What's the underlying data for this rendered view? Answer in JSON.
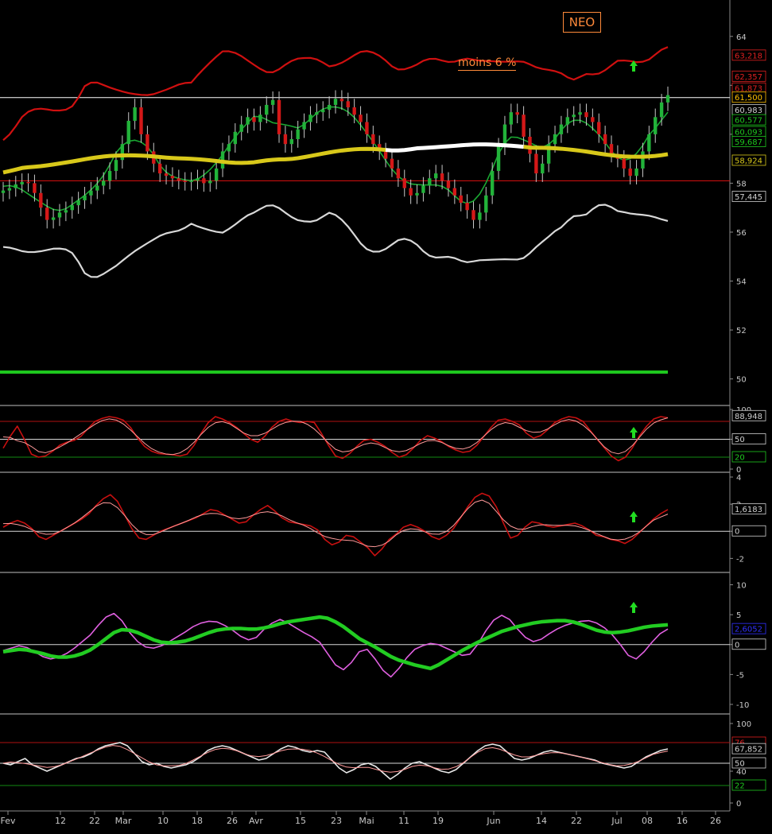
{
  "symbol": "NEO",
  "annotation": "moins 6 %",
  "colors": {
    "background": "#000000",
    "axis": "#8a8a8a",
    "bollinger": "#d01010",
    "bollinger_lower": "#d8d8d8",
    "ma_long": "#d8c81a",
    "ma_long_flat": "#ffffff",
    "ma_short": "#1aa832",
    "candle_up": "#22b33a",
    "candle_down": "#d41818",
    "support": "#e01010",
    "target": "#1ec81e",
    "note": "#ff8a3a",
    "signal": "#22dd22"
  },
  "x_axis": {
    "labels": [
      "Fev",
      "12",
      "22",
      "Mar",
      "10",
      "18",
      "26",
      "Avr",
      "15",
      "23",
      "Mai",
      "11",
      "19",
      "Jun",
      "14",
      "22",
      "Jul",
      "08",
      "16",
      "26"
    ]
  },
  "chart_data": [
    {
      "type": "candlestick",
      "panel": "price",
      "ylim": [
        49.5,
        65
      ],
      "yticks": [
        50,
        52,
        54,
        56,
        58,
        60,
        62,
        64
      ],
      "last_close": 61.5,
      "hlines": [
        {
          "value": 61.5,
          "label": "61,500",
          "color": "#ffffff"
        },
        {
          "value": 58.1,
          "label": "",
          "color": "#e01010"
        },
        {
          "value": 50.279,
          "label": "50,279",
          "color": "#1ec81e"
        }
      ],
      "value_labels": [
        {
          "value": 63.218,
          "label": "63,218",
          "color": "#e02020"
        },
        {
          "value": 62.357,
          "label": "62,357",
          "color": "#e02020"
        },
        {
          "value": 61.873,
          "label": "61,873",
          "color": "#e02020"
        },
        {
          "value": 61.5,
          "label": "61,500",
          "color": "#ffc000"
        },
        {
          "value": 60.983,
          "label": "60,983",
          "color": "#d0d0d0"
        },
        {
          "value": 60.577,
          "label": "60,577",
          "color": "#1ec81e"
        },
        {
          "value": 60.093,
          "label": "60,093",
          "color": "#1ec81e"
        },
        {
          "value": 59.687,
          "label": "59,687",
          "color": "#1ec81e"
        },
        {
          "value": 58.924,
          "label": "58,924",
          "color": "#d8c81a"
        },
        {
          "value": 57.445,
          "label": "57,445",
          "color": "#d0d0d0"
        }
      ],
      "close": [
        57.7,
        57.8,
        57.95,
        58.05,
        58.0,
        57.6,
        57.0,
        56.5,
        56.6,
        56.8,
        56.9,
        57.1,
        57.3,
        57.5,
        57.7,
        57.9,
        58.1,
        58.5,
        58.95,
        59.6,
        60.55,
        61.1,
        60.0,
        59.3,
        58.8,
        58.4,
        58.3,
        58.2,
        58.1,
        58.05,
        58.1,
        58.2,
        58.0,
        58.1,
        58.6,
        59.3,
        59.6,
        60.1,
        60.4,
        60.7,
        60.5,
        60.8,
        61.2,
        61.4,
        60.0,
        59.6,
        59.8,
        60.2,
        60.5,
        60.8,
        60.9,
        61.0,
        61.2,
        61.45,
        61.35,
        61.1,
        60.8,
        60.5,
        60.0,
        59.6,
        59.3,
        59.0,
        58.6,
        58.2,
        57.8,
        57.5,
        57.6,
        57.9,
        58.2,
        58.4,
        58.1,
        57.8,
        57.5,
        57.2,
        56.9,
        56.5,
        56.8,
        57.5,
        58.5,
        59.5,
        60.4,
        60.9,
        60.8,
        59.9,
        59.2,
        58.4,
        58.8,
        59.6,
        60.0,
        60.4,
        60.7,
        60.8,
        60.9,
        60.7,
        60.5,
        60.0,
        59.6,
        59.2,
        59.0,
        58.6,
        58.3,
        58.6,
        59.3,
        60.0,
        60.7,
        61.3,
        61.6
      ]
    },
    {
      "type": "line",
      "panel": "stochastic",
      "ylim": [
        0,
        100
      ],
      "yticks": [
        0,
        50,
        100
      ],
      "ref_lines": [
        80,
        50,
        20
      ],
      "value_labels": [
        {
          "value": 88.948,
          "label": "88,948",
          "color": "#d0d0d0"
        },
        {
          "value": 50,
          "label": "50",
          "color": "#d0d0d0"
        },
        {
          "value": 20,
          "label": "20",
          "color": "#1ec81e"
        }
      ],
      "values": [
        35,
        55,
        72,
        50,
        25,
        20,
        22,
        30,
        40,
        45,
        48,
        55,
        68,
        80,
        85,
        88,
        86,
        82,
        70,
        52,
        38,
        30,
        26,
        25,
        24,
        22,
        25,
        40,
        60,
        78,
        88,
        84,
        78,
        70,
        60,
        50,
        45,
        55,
        70,
        80,
        84,
        80,
        78,
        80,
        78,
        60,
        40,
        22,
        18,
        26,
        38,
        48,
        50,
        45,
        38,
        28,
        20,
        24,
        35,
        48,
        56,
        52,
        46,
        38,
        32,
        28,
        30,
        40,
        55,
        70,
        82,
        84,
        80,
        74,
        60,
        52,
        56,
        66,
        78,
        84,
        88,
        86,
        80,
        65,
        50,
        36,
        22,
        14,
        20,
        36,
        56,
        72,
        84,
        88,
        86
      ]
    },
    {
      "type": "line",
      "panel": "momentum",
      "ylim": [
        -2.8,
        4
      ],
      "yticks": [
        -2,
        0,
        2,
        4
      ],
      "ref_lines": [
        0
      ],
      "value_labels": [
        {
          "value": 1.6183,
          "label": "1,6183",
          "color": "#d0d0d0"
        },
        {
          "value": 0,
          "label": "0",
          "color": "#d0d0d0"
        }
      ],
      "values": [
        0.3,
        0.6,
        0.8,
        0.6,
        0.2,
        -0.4,
        -0.6,
        -0.3,
        0.0,
        0.3,
        0.6,
        0.9,
        1.3,
        1.9,
        2.4,
        2.7,
        2.2,
        1.2,
        0.2,
        -0.5,
        -0.6,
        -0.3,
        0.0,
        0.2,
        0.4,
        0.6,
        0.8,
        1.0,
        1.3,
        1.6,
        1.5,
        1.2,
        0.9,
        0.6,
        0.7,
        1.2,
        1.6,
        1.9,
        1.5,
        1.0,
        0.7,
        0.6,
        0.5,
        0.4,
        0.1,
        -0.6,
        -1.0,
        -0.8,
        -0.3,
        -0.4,
        -0.8,
        -1.2,
        -1.8,
        -1.3,
        -0.6,
        -0.2,
        0.3,
        0.5,
        0.3,
        0.0,
        -0.4,
        -0.6,
        -0.3,
        0.2,
        1.0,
        1.8,
        2.5,
        2.8,
        2.6,
        1.8,
        0.6,
        -0.5,
        -0.3,
        0.3,
        0.7,
        0.6,
        0.4,
        0.3,
        0.4,
        0.5,
        0.6,
        0.4,
        0.1,
        -0.3,
        -0.4,
        -0.6,
        -0.7,
        -0.9,
        -0.6,
        -0.1,
        0.4,
        0.9,
        1.3,
        1.6
      ]
    },
    {
      "type": "line",
      "panel": "macd",
      "ylim": [
        -10.8,
        11
      ],
      "yticks": [
        -10,
        -5,
        0,
        5,
        10
      ],
      "ref_lines": [
        0
      ],
      "value_labels": [
        {
          "value": 2.6052,
          "label": "2,6052",
          "color": "#3030ff"
        },
        {
          "value": 0,
          "label": "0",
          "color": "#d0d0d0"
        }
      ],
      "series": [
        {
          "values": [
            -1,
            -0.6,
            -0.2,
            -0.5,
            -1.2,
            -2.0,
            -2.4,
            -2.1,
            -1.5,
            -0.6,
            0.5,
            1.6,
            3.2,
            4.6,
            5.2,
            4.0,
            2.0,
            0.5,
            -0.4,
            -0.6,
            -0.2,
            0.5,
            1.3,
            2.1,
            3.0,
            3.6,
            3.9,
            3.8,
            3.2,
            2.4,
            1.4,
            0.8,
            1.2,
            2.6,
            3.6,
            4.2,
            3.6,
            2.8,
            2.0,
            1.3,
            0.4,
            -1.5,
            -3.4,
            -4.2,
            -3.0,
            -1.2,
            -0.8,
            -2.4,
            -4.3,
            -5.4,
            -4.0,
            -2.2,
            -0.8,
            -0.2,
            0.2,
            0.0,
            -0.6,
            -1.2,
            -1.8,
            -1.6,
            0.1,
            2.3,
            4.1,
            4.9,
            4.2,
            2.6,
            1.2,
            0.5,
            0.9,
            1.8,
            2.6,
            3.2,
            3.6,
            3.9,
            4.0,
            3.6,
            2.8,
            1.6,
            0.0,
            -1.8,
            -2.4,
            -1.2,
            0.4,
            1.8,
            2.6
          ]
        },
        {
          "values": [
            -1.2,
            -1.0,
            -0.8,
            -0.9,
            -1.2,
            -1.5,
            -1.9,
            -2.1,
            -2.1,
            -1.9,
            -1.5,
            -0.9,
            0.0,
            1.0,
            2.0,
            2.5,
            2.4,
            2.0,
            1.4,
            0.8,
            0.4,
            0.3,
            0.4,
            0.6,
            1.0,
            1.5,
            2.0,
            2.4,
            2.6,
            2.7,
            2.7,
            2.6,
            2.6,
            2.8,
            3.1,
            3.5,
            3.8,
            4.0,
            4.2,
            4.4,
            4.6,
            4.4,
            3.8,
            3.0,
            2.0,
            1.0,
            0.3,
            -0.4,
            -1.2,
            -2.0,
            -2.6,
            -3.0,
            -3.4,
            -3.7,
            -4.0,
            -3.4,
            -2.6,
            -1.8,
            -1.0,
            -0.3,
            0.4,
            1.0,
            1.6,
            2.2,
            2.6,
            3.0,
            3.3,
            3.6,
            3.8,
            3.9,
            4.0,
            4.0,
            3.8,
            3.4,
            2.9,
            2.4,
            2.1,
            2.0,
            2.1,
            2.3,
            2.6,
            2.9,
            3.1,
            3.2,
            3.3
          ]
        }
      ]
    },
    {
      "type": "line",
      "panel": "rsi",
      "ylim": [
        -4,
        104
      ],
      "yticks": [
        0,
        40,
        100
      ],
      "ref_lines": [
        76,
        50,
        22
      ],
      "value_labels": [
        {
          "value": 76,
          "label": "76",
          "color": "#e02020"
        },
        {
          "value": 67.852,
          "label": "67,852",
          "color": "#d0d0d0"
        },
        {
          "value": 50,
          "label": "50",
          "color": "#d0d0d0"
        },
        {
          "value": 22,
          "label": "22",
          "color": "#1ec81e"
        }
      ],
      "values": [
        50,
        48,
        52,
        56,
        48,
        44,
        40,
        44,
        48,
        52,
        56,
        58,
        62,
        68,
        72,
        74,
        76,
        72,
        62,
        52,
        48,
        50,
        46,
        44,
        46,
        48,
        52,
        58,
        66,
        70,
        72,
        70,
        66,
        62,
        58,
        54,
        56,
        62,
        68,
        72,
        70,
        66,
        64,
        66,
        64,
        54,
        44,
        38,
        42,
        48,
        50,
        46,
        38,
        30,
        36,
        44,
        50,
        52,
        48,
        44,
        40,
        38,
        42,
        50,
        58,
        66,
        72,
        74,
        72,
        64,
        56,
        54,
        56,
        60,
        64,
        66,
        64,
        62,
        60,
        58,
        56,
        54,
        50,
        48,
        46,
        44,
        46,
        52,
        58,
        62,
        66,
        68
      ]
    }
  ]
}
